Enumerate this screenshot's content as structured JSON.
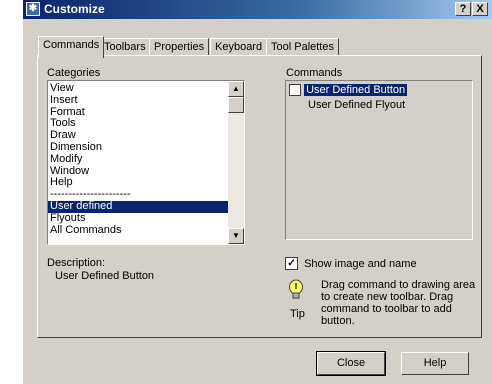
{
  "window": {
    "title": "Customize",
    "help_button": "?",
    "close_button": "X"
  },
  "tabs": [
    {
      "label": "Commands",
      "active": true
    },
    {
      "label": "Toolbars",
      "active": false
    },
    {
      "label": "Properties",
      "active": false
    },
    {
      "label": "Keyboard",
      "active": false
    },
    {
      "label": "Tool Palettes",
      "active": false
    }
  ],
  "categories": {
    "label": "Categories",
    "items": [
      "View",
      "Insert",
      "Format",
      "Tools",
      "Draw",
      "Dimension",
      "Modify",
      "Window",
      "Help",
      "----------------------",
      "User defined",
      "Flyouts",
      "All Commands"
    ],
    "selected": "User defined"
  },
  "commands": {
    "label": "Commands",
    "items": [
      {
        "label": "User Defined Button",
        "selected": true,
        "has_icon": true
      },
      {
        "label": "User Defined Flyout",
        "selected": false,
        "has_icon": false
      }
    ]
  },
  "description": {
    "label": "Description:",
    "value": "User Defined Button"
  },
  "show_image_and_name": {
    "label": "Show image and name",
    "checked": true
  },
  "tip": {
    "icon": "lightbulb-icon",
    "label": "Tip",
    "text": "Drag command to drawing area to create new toolbar. Drag command to toolbar to add button."
  },
  "buttons": {
    "close": "Close",
    "help": "Help"
  }
}
